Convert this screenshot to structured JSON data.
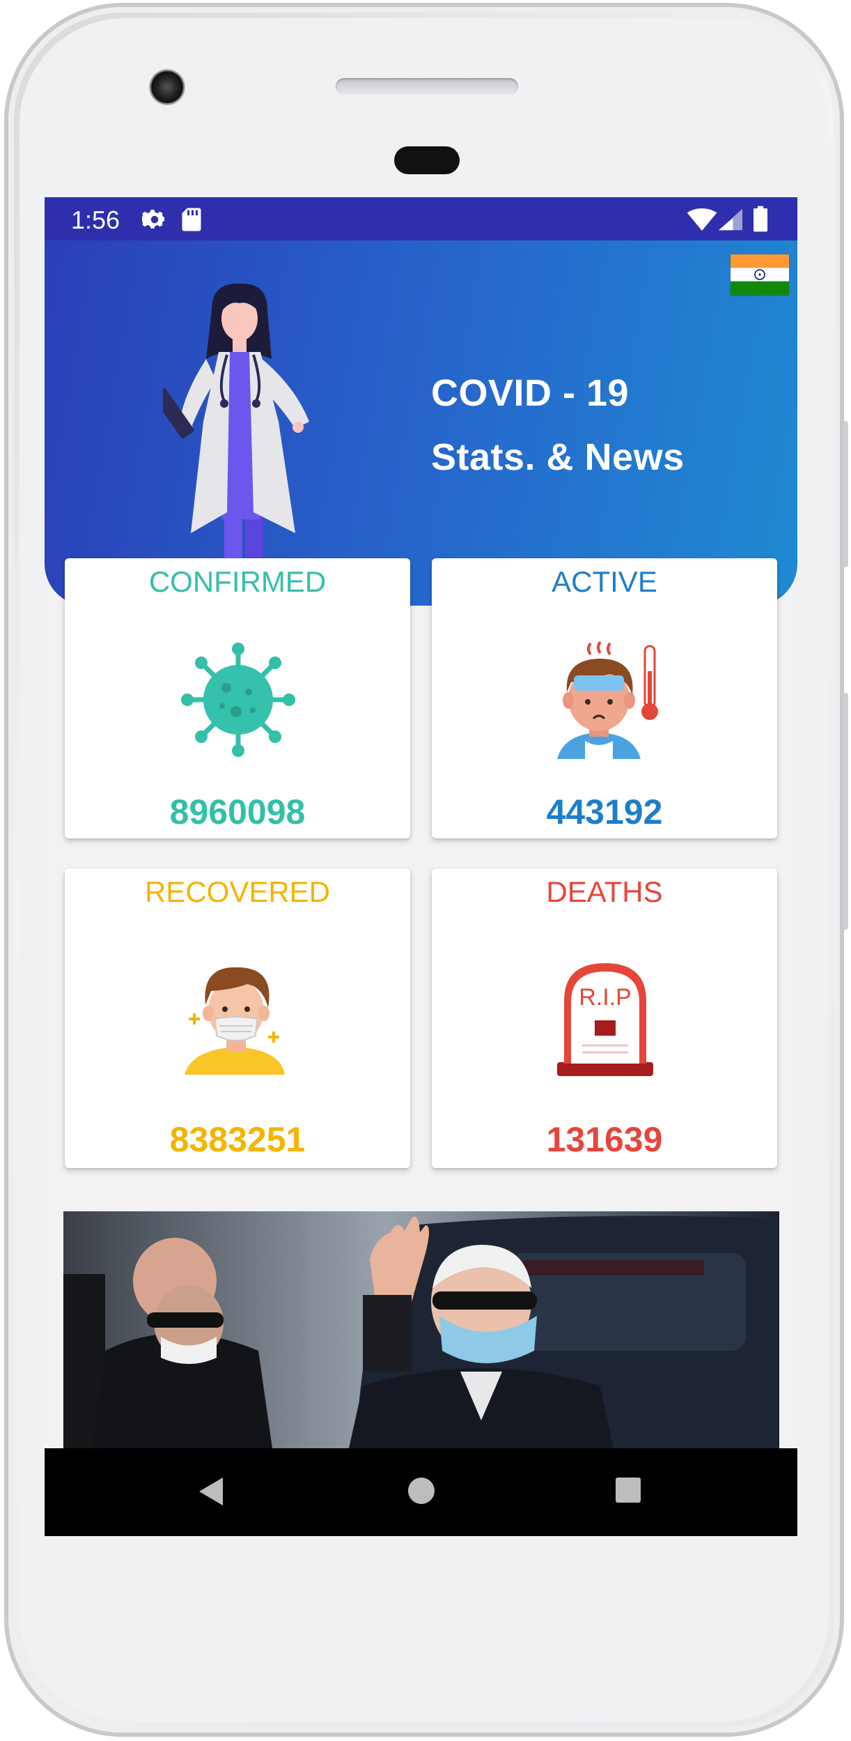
{
  "status_bar": {
    "time": "1:56",
    "icons_left": [
      "gear-icon",
      "sd-card-icon"
    ],
    "icons_right": [
      "wifi-icon",
      "signal-icon",
      "battery-icon"
    ],
    "color": "#2f2fae"
  },
  "header": {
    "title_line1": "COVID - 19",
    "title_line2": "Stats. & News",
    "flag": "india-flag-icon",
    "gradient": [
      "#2a3fb8",
      "#1f8ad2"
    ]
  },
  "stats": [
    {
      "label": "CONFIRMED",
      "value": "8960098",
      "color": "#33bfa8",
      "icon": "virus-icon"
    },
    {
      "label": "ACTIVE",
      "value": "443192",
      "color": "#1e7ec8",
      "icon": "sick-person-icon"
    },
    {
      "label": "RECOVERED",
      "value": "8383251",
      "color": "#f5b400",
      "icon": "masked-person-icon"
    },
    {
      "label": "DEATHS",
      "value": "131639",
      "color": "#e5463a",
      "icon": "tombstone-icon"
    }
  ],
  "tombstone_text": "R.I.P",
  "news": {
    "image": "news-photo"
  },
  "nav": {
    "buttons": [
      "back-icon",
      "home-icon",
      "recents-icon"
    ]
  }
}
